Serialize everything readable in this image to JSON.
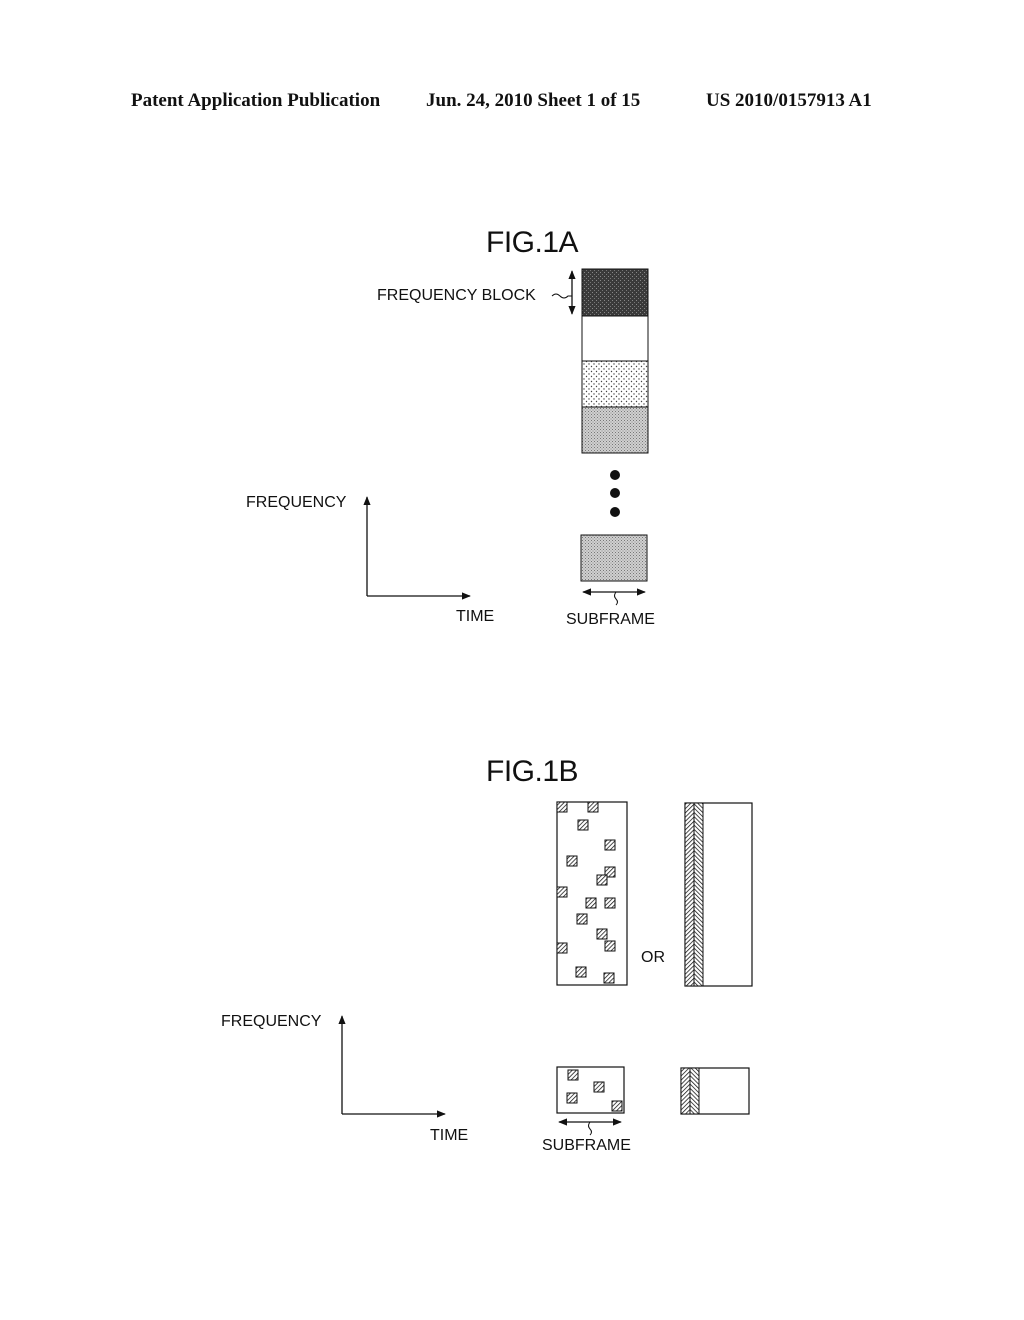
{
  "header": {
    "publication": "Patent Application Publication",
    "date_sheet": "Jun. 24, 2010  Sheet 1 of 15",
    "patent_number": "US 2010/0157913 A1"
  },
  "fig1a": {
    "title": "FIG.1A",
    "frequency_block_label": "FREQUENCY BLOCK",
    "axis_y_label": "FREQUENCY",
    "axis_x_label": "TIME",
    "subframe_label": "SUBFRAME",
    "blocks": [
      {
        "fill": "dense-dark"
      },
      {
        "fill": "white"
      },
      {
        "fill": "light-dots"
      },
      {
        "fill": "medium-dots"
      }
    ],
    "ellipsis_dots": 3,
    "last_block": {
      "fill": "medium-dots"
    }
  },
  "fig1b": {
    "title": "FIG.1B",
    "or_label": "OR",
    "axis_y_label": "FREQUENCY",
    "axis_x_label": "TIME",
    "subframe_label": "SUBFRAME",
    "option_a": "distributed hatched pilot squares",
    "option_b": "hatched pilot column at subframe start"
  }
}
